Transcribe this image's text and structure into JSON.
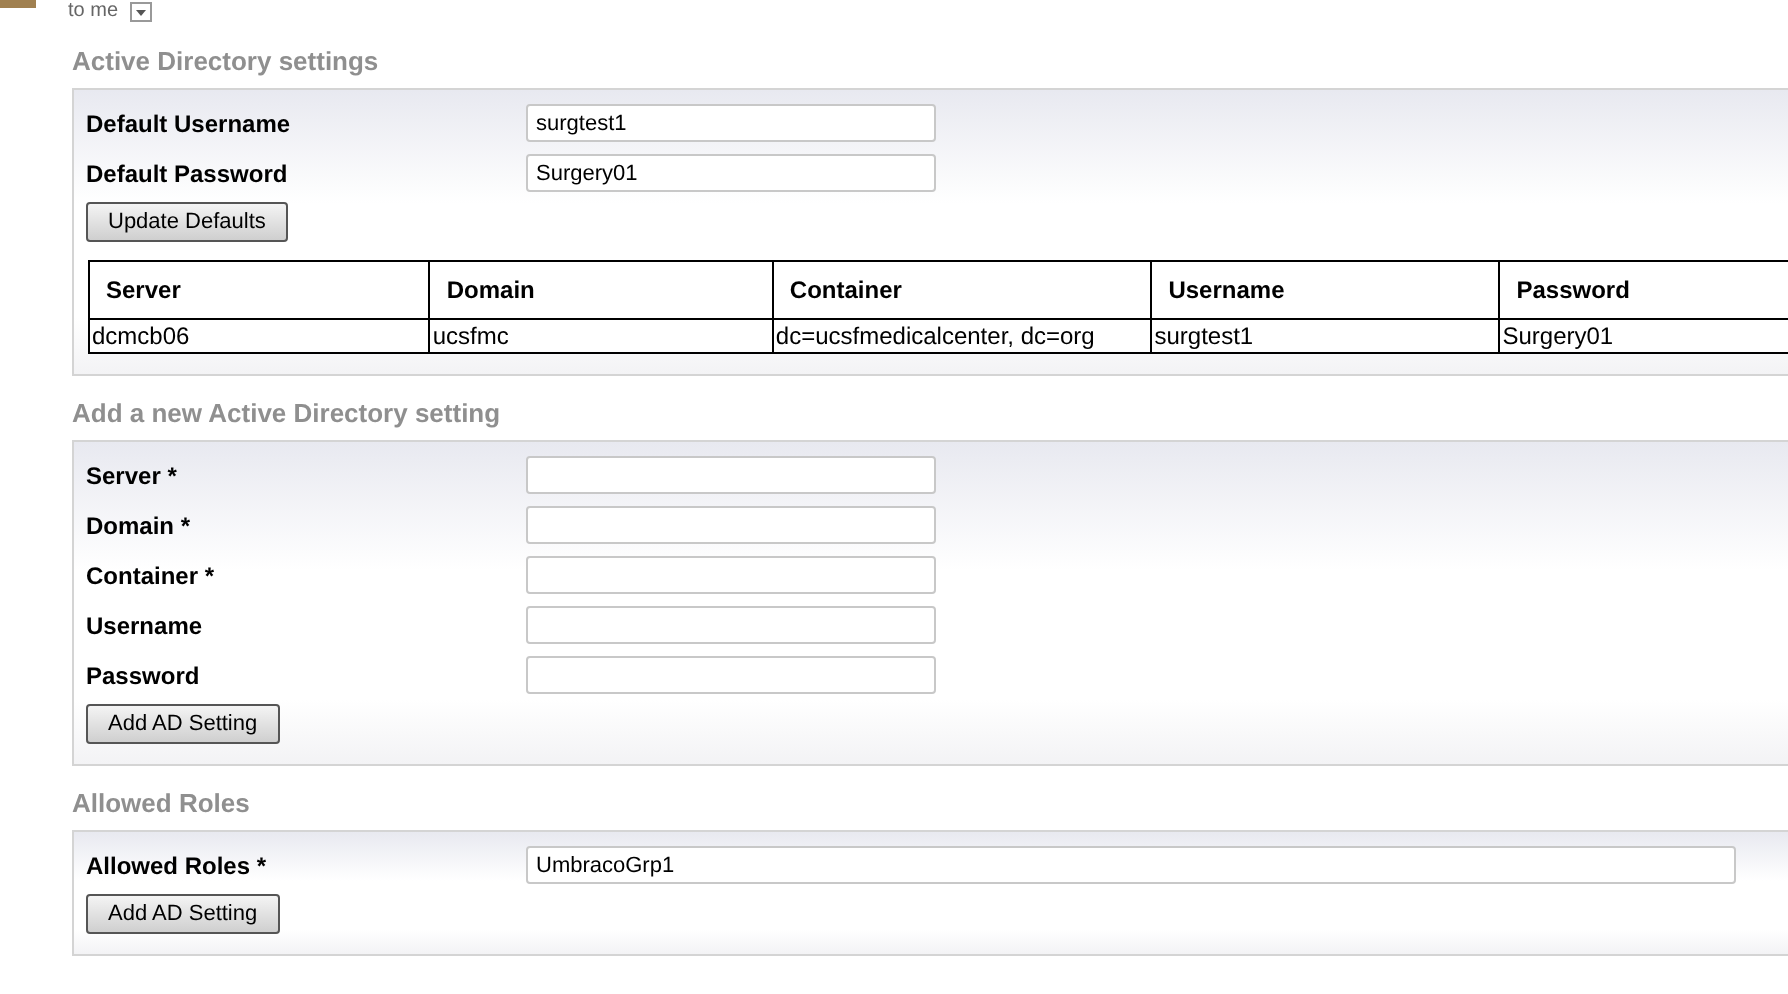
{
  "top_bar": {
    "text": "to me"
  },
  "sections": [
    {
      "kind": "defaults",
      "title": "Active Directory settings",
      "fields": [
        {
          "label": "Default Username",
          "value": "surgtest1"
        },
        {
          "label": "Default Password",
          "value": "Surgery01"
        }
      ],
      "button": "Update Defaults",
      "table": {
        "columns": [
          "Server",
          "Domain",
          "Container",
          "Username",
          "Password"
        ],
        "rows": [
          [
            "dcmcb06",
            "ucsfmc",
            "dc=ucsfmedicalcenter, dc=org",
            "surgtest1",
            "Surgery01"
          ]
        ]
      }
    },
    {
      "kind": "form",
      "title": "Add a new Active Directory setting",
      "fields": [
        {
          "label": "Server *"
        },
        {
          "label": "Domain *"
        },
        {
          "label": "Container *"
        },
        {
          "label": "Username"
        },
        {
          "label": "Password"
        }
      ],
      "button": "Add AD Setting"
    },
    {
      "kind": "wide",
      "title": "Allowed Roles",
      "fields": [
        {
          "label": "Allowed Roles *",
          "value": "UmbracoGrp1"
        }
      ],
      "button": "Add AD Setting"
    }
  ]
}
